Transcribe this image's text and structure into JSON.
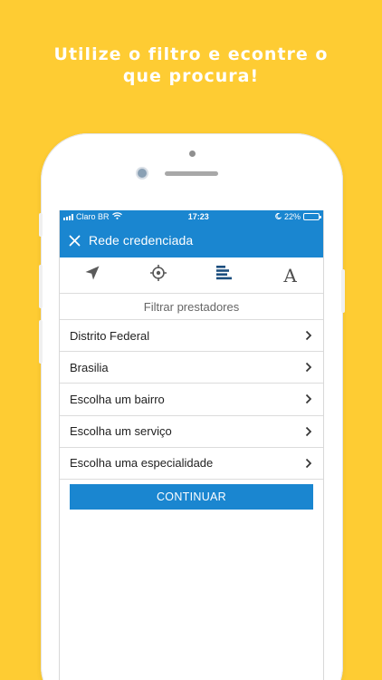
{
  "headline": {
    "line1": "Utilize o filtro e econtre o",
    "line2": "que procura!"
  },
  "colors": {
    "background": "#FECC33",
    "accent": "#1A86D0",
    "headline_text": "#FFFFFF"
  },
  "status_bar": {
    "carrier": "Claro BR",
    "time": "17:23",
    "battery": "22%",
    "battery_level": 0.22,
    "icons": [
      "signal-icon",
      "wifi-icon",
      "moon-icon",
      "battery-icon"
    ]
  },
  "nav": {
    "title": "Rede credenciada",
    "close_icon": "close-icon"
  },
  "toolbar": {
    "icons": [
      "location-arrow-icon",
      "crosshair-icon",
      "list-filter-icon",
      "font-size-icon"
    ],
    "selected_index": 2,
    "font_glyph": "A"
  },
  "filter": {
    "title": "Filtrar prestadores",
    "items": [
      {
        "label": "Distrito Federal"
      },
      {
        "label": "Brasilia"
      },
      {
        "label": "Escolha um bairro"
      },
      {
        "label": "Escolha um serviço"
      },
      {
        "label": "Escolha uma especialidade"
      }
    ],
    "continue_label": "CONTINUAR"
  }
}
